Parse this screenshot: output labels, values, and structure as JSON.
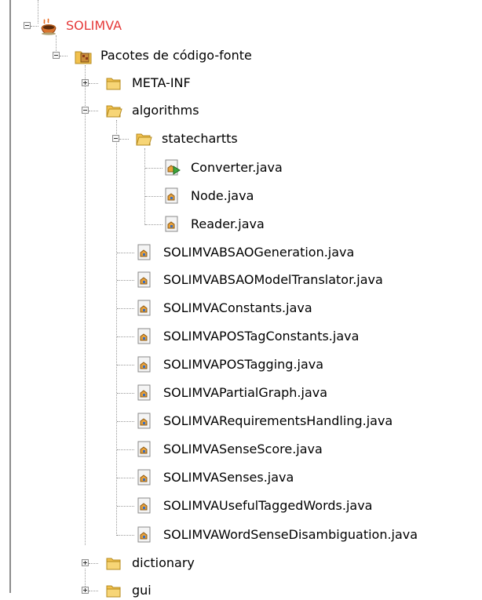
{
  "tree": {
    "project": {
      "label": "SOLIMVA"
    },
    "source_packages": {
      "label": "Pacotes de código-fonte"
    },
    "folders": {
      "meta_inf": "META-INF",
      "algorithms": "algorithms",
      "statechartts": "statechartts",
      "dictionary": "dictionary",
      "gui": "gui"
    },
    "statechartts_files": [
      "Converter.java",
      "Node.java",
      "Reader.java"
    ],
    "algorithms_files": [
      "SOLIMVABSAOGeneration.java",
      "SOLIMVABSAOModelTranslator.java",
      "SOLIMVAConstants.java",
      "SOLIMVAPOSTagConstants.java",
      "SOLIMVAPOSTagging.java",
      "SOLIMVAPartialGraph.java",
      "SOLIMVARequirementsHandling.java",
      "SOLIMVASenseScore.java",
      "SOLIMVASenses.java",
      "SOLIMVAUsefulTaggedWords.java",
      "SOLIMVAWordSenseDisambiguation.java"
    ]
  },
  "colors": {
    "project_label": "#e53a3a",
    "folder": "#f2c14e",
    "tree_lines": "#9a9a9a"
  },
  "icons": {
    "project": "coffee-cup-icon",
    "source_packages": "package-folder-icon",
    "folder": "folder-icon",
    "java_file": "java-file-icon",
    "main_java_file": "java-main-file-icon"
  }
}
